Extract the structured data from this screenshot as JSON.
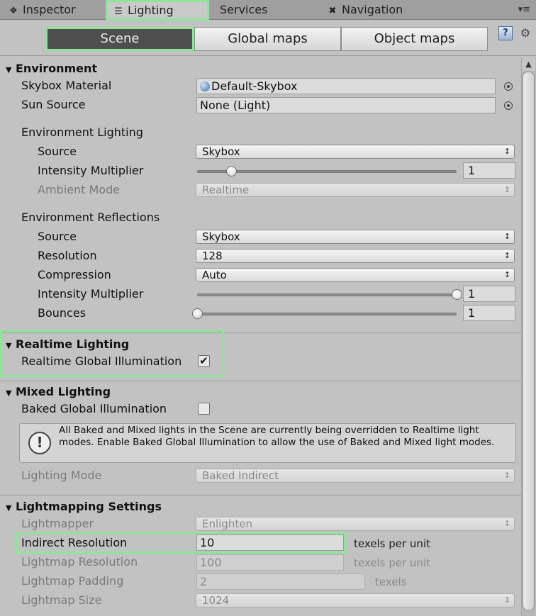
{
  "tabs": [
    {
      "label": "Inspector",
      "icon": "info-icon"
    },
    {
      "label": "Lighting",
      "icon": "lighting-sliders-icon"
    },
    {
      "label": "Services",
      "icon": ""
    },
    {
      "label": "Navigation",
      "icon": "navigation-icon"
    }
  ],
  "toolbar": {
    "segments": [
      "Scene",
      "Global maps",
      "Object maps"
    ],
    "active_segment": "Scene"
  },
  "environment": {
    "header": "Environment",
    "skybox_material_label": "Skybox Material",
    "skybox_material_value": "Default-Skybox",
    "sun_source_label": "Sun Source",
    "sun_source_value": "None (Light)",
    "env_lighting_label": "Environment Lighting",
    "source_label": "Source",
    "source_value": "Skybox",
    "intensity_label": "Intensity Multiplier",
    "intensity_value": "1",
    "ambient_mode_label": "Ambient Mode",
    "ambient_mode_value": "Realtime",
    "env_reflections_label": "Environment Reflections",
    "refl_source_label": "Source",
    "refl_source_value": "Skybox",
    "resolution_label": "Resolution",
    "resolution_value": "128",
    "compression_label": "Compression",
    "compression_value": "Auto",
    "refl_intensity_label": "Intensity Multiplier",
    "refl_intensity_value": "1",
    "bounces_label": "Bounces",
    "bounces_value": "1"
  },
  "realtime": {
    "header": "Realtime Lighting",
    "rgi_label": "Realtime Global Illumination",
    "rgi_checked": true
  },
  "mixed": {
    "header": "Mixed Lighting",
    "bgi_label": "Baked Global Illumination",
    "bgi_checked": false,
    "info": "All Baked and Mixed lights in the Scene are currently being overridden to Realtime light modes. Enable Baked Global Illumination to allow the use of Baked and Mixed light modes.",
    "lighting_mode_label": "Lighting Mode",
    "lighting_mode_value": "Baked Indirect"
  },
  "lightmapping": {
    "header": "Lightmapping Settings",
    "lightmapper_label": "Lightmapper",
    "lightmapper_value": "Enlighten",
    "indirect_res_label": "Indirect Resolution",
    "indirect_res_value": "10",
    "indirect_res_unit": "texels per unit",
    "lightmap_res_label": "Lightmap Resolution",
    "lightmap_res_value": "100",
    "lightmap_res_unit": "texels per unit",
    "padding_label": "Lightmap Padding",
    "padding_value": "2",
    "padding_unit": "texels",
    "size_label": "Lightmap Size",
    "size_value": "1024"
  },
  "slider_levels": {
    "env_intensity": 0.13,
    "refl_intensity": 1.0,
    "bounces": 0.0
  },
  "colors": {
    "highlight": "#8ee59a",
    "active_segment_bg": "#4e4e4e",
    "panel_bg": "#c2c2c2"
  }
}
